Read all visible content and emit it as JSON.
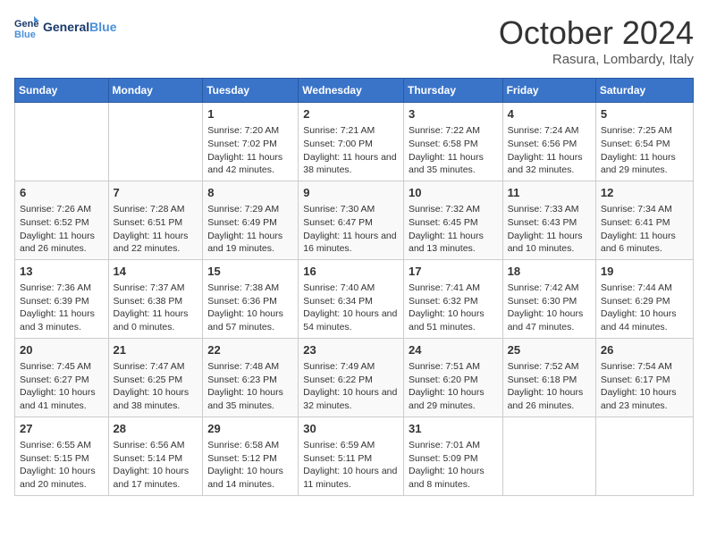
{
  "header": {
    "logo_line1": "General",
    "logo_line2": "Blue",
    "month": "October 2024",
    "location": "Rasura, Lombardy, Italy"
  },
  "days_of_week": [
    "Sunday",
    "Monday",
    "Tuesday",
    "Wednesday",
    "Thursday",
    "Friday",
    "Saturday"
  ],
  "weeks": [
    [
      {
        "day": "",
        "info": ""
      },
      {
        "day": "",
        "info": ""
      },
      {
        "day": "1",
        "info": "Sunrise: 7:20 AM\nSunset: 7:02 PM\nDaylight: 11 hours and 42 minutes."
      },
      {
        "day": "2",
        "info": "Sunrise: 7:21 AM\nSunset: 7:00 PM\nDaylight: 11 hours and 38 minutes."
      },
      {
        "day": "3",
        "info": "Sunrise: 7:22 AM\nSunset: 6:58 PM\nDaylight: 11 hours and 35 minutes."
      },
      {
        "day": "4",
        "info": "Sunrise: 7:24 AM\nSunset: 6:56 PM\nDaylight: 11 hours and 32 minutes."
      },
      {
        "day": "5",
        "info": "Sunrise: 7:25 AM\nSunset: 6:54 PM\nDaylight: 11 hours and 29 minutes."
      }
    ],
    [
      {
        "day": "6",
        "info": "Sunrise: 7:26 AM\nSunset: 6:52 PM\nDaylight: 11 hours and 26 minutes."
      },
      {
        "day": "7",
        "info": "Sunrise: 7:28 AM\nSunset: 6:51 PM\nDaylight: 11 hours and 22 minutes."
      },
      {
        "day": "8",
        "info": "Sunrise: 7:29 AM\nSunset: 6:49 PM\nDaylight: 11 hours and 19 minutes."
      },
      {
        "day": "9",
        "info": "Sunrise: 7:30 AM\nSunset: 6:47 PM\nDaylight: 11 hours and 16 minutes."
      },
      {
        "day": "10",
        "info": "Sunrise: 7:32 AM\nSunset: 6:45 PM\nDaylight: 11 hours and 13 minutes."
      },
      {
        "day": "11",
        "info": "Sunrise: 7:33 AM\nSunset: 6:43 PM\nDaylight: 11 hours and 10 minutes."
      },
      {
        "day": "12",
        "info": "Sunrise: 7:34 AM\nSunset: 6:41 PM\nDaylight: 11 hours and 6 minutes."
      }
    ],
    [
      {
        "day": "13",
        "info": "Sunrise: 7:36 AM\nSunset: 6:39 PM\nDaylight: 11 hours and 3 minutes."
      },
      {
        "day": "14",
        "info": "Sunrise: 7:37 AM\nSunset: 6:38 PM\nDaylight: 11 hours and 0 minutes."
      },
      {
        "day": "15",
        "info": "Sunrise: 7:38 AM\nSunset: 6:36 PM\nDaylight: 10 hours and 57 minutes."
      },
      {
        "day": "16",
        "info": "Sunrise: 7:40 AM\nSunset: 6:34 PM\nDaylight: 10 hours and 54 minutes."
      },
      {
        "day": "17",
        "info": "Sunrise: 7:41 AM\nSunset: 6:32 PM\nDaylight: 10 hours and 51 minutes."
      },
      {
        "day": "18",
        "info": "Sunrise: 7:42 AM\nSunset: 6:30 PM\nDaylight: 10 hours and 47 minutes."
      },
      {
        "day": "19",
        "info": "Sunrise: 7:44 AM\nSunset: 6:29 PM\nDaylight: 10 hours and 44 minutes."
      }
    ],
    [
      {
        "day": "20",
        "info": "Sunrise: 7:45 AM\nSunset: 6:27 PM\nDaylight: 10 hours and 41 minutes."
      },
      {
        "day": "21",
        "info": "Sunrise: 7:47 AM\nSunset: 6:25 PM\nDaylight: 10 hours and 38 minutes."
      },
      {
        "day": "22",
        "info": "Sunrise: 7:48 AM\nSunset: 6:23 PM\nDaylight: 10 hours and 35 minutes."
      },
      {
        "day": "23",
        "info": "Sunrise: 7:49 AM\nSunset: 6:22 PM\nDaylight: 10 hours and 32 minutes."
      },
      {
        "day": "24",
        "info": "Sunrise: 7:51 AM\nSunset: 6:20 PM\nDaylight: 10 hours and 29 minutes."
      },
      {
        "day": "25",
        "info": "Sunrise: 7:52 AM\nSunset: 6:18 PM\nDaylight: 10 hours and 26 minutes."
      },
      {
        "day": "26",
        "info": "Sunrise: 7:54 AM\nSunset: 6:17 PM\nDaylight: 10 hours and 23 minutes."
      }
    ],
    [
      {
        "day": "27",
        "info": "Sunrise: 6:55 AM\nSunset: 5:15 PM\nDaylight: 10 hours and 20 minutes."
      },
      {
        "day": "28",
        "info": "Sunrise: 6:56 AM\nSunset: 5:14 PM\nDaylight: 10 hours and 17 minutes."
      },
      {
        "day": "29",
        "info": "Sunrise: 6:58 AM\nSunset: 5:12 PM\nDaylight: 10 hours and 14 minutes."
      },
      {
        "day": "30",
        "info": "Sunrise: 6:59 AM\nSunset: 5:11 PM\nDaylight: 10 hours and 11 minutes."
      },
      {
        "day": "31",
        "info": "Sunrise: 7:01 AM\nSunset: 5:09 PM\nDaylight: 10 hours and 8 minutes."
      },
      {
        "day": "",
        "info": ""
      },
      {
        "day": "",
        "info": ""
      }
    ]
  ]
}
